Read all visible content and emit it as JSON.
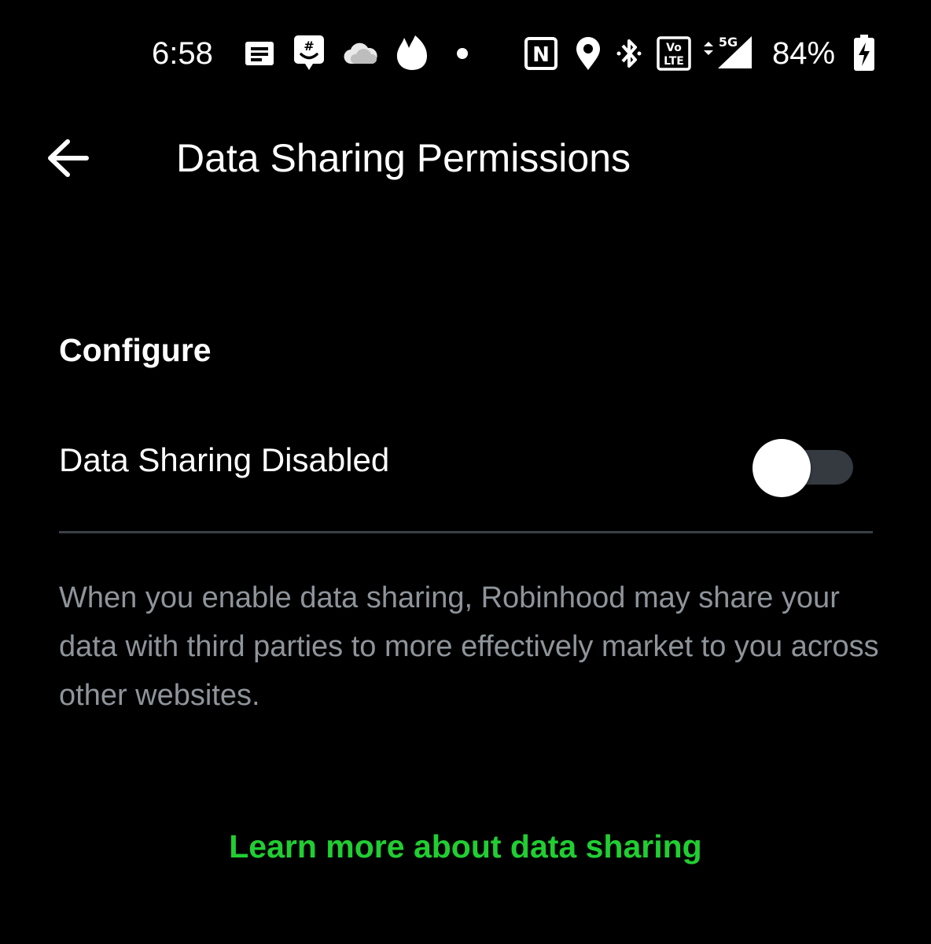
{
  "status_bar": {
    "time": "6:58",
    "battery_percent": "84%",
    "network_badge": "5G",
    "volte_badge_top": "Vo",
    "volte_badge_bottom": "LTE",
    "nfc_glyph": "N",
    "left_icons": [
      "messages-icon",
      "groupme-icon",
      "onedrive-cloud-icon",
      "tinder-flame-icon",
      "notification-dot-icon"
    ],
    "right_icons": [
      "nfc-icon",
      "location-icon",
      "bluetooth-icon",
      "volte-icon",
      "signal-5g-icon",
      "battery-charging-icon"
    ]
  },
  "toolbar": {
    "title": "Data Sharing Permissions",
    "back_icon": "arrow-left-icon"
  },
  "configure": {
    "heading": "Configure",
    "setting_label": "Data Sharing Disabled",
    "toggle_on": false
  },
  "description": "When you enable data sharing, Robinhood may share your data with third parties to more effectively market to you across other websites.",
  "learn_more": "Learn more about data sharing",
  "colors": {
    "background": "#000000",
    "text": "#ffffff",
    "description_text": "#8e949a",
    "accent_green": "#21ce32",
    "toggle_track": "#353a40",
    "divider": "#3b3f46"
  }
}
